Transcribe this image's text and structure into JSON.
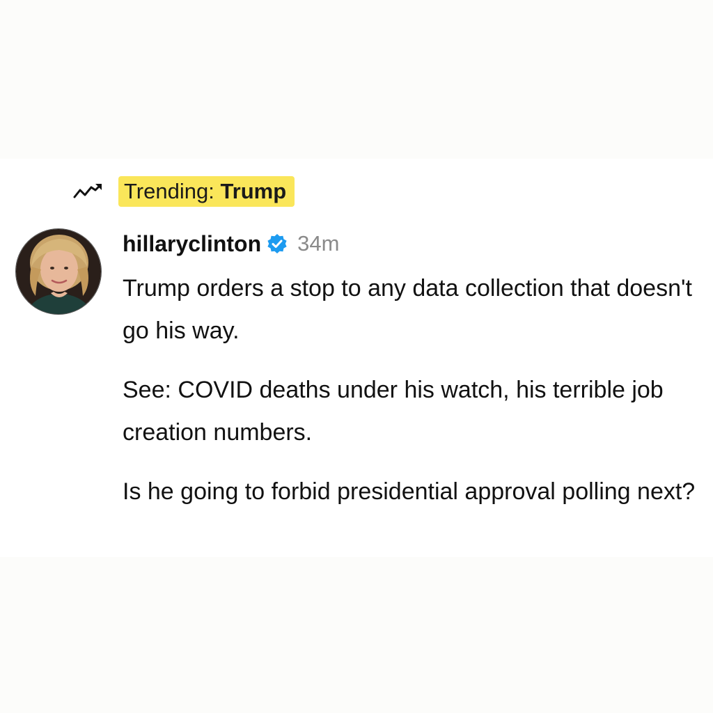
{
  "trending": {
    "prefix": "Trending: ",
    "topic": "Trump",
    "icon": "trending-up-arrow-icon",
    "highlight_color": "#fae65a"
  },
  "post": {
    "username": "hillaryclinton",
    "verified_icon": "verified-badge-icon",
    "verified_color": "#1d9bf0",
    "timestamp": "34m",
    "paragraphs": [
      "Trump orders a stop to any data collection that doesn't go his way.",
      "See: COVID deaths under his watch, his terrible job creation numbers.",
      "Is he going to forbid presidential approval polling next?"
    ]
  }
}
